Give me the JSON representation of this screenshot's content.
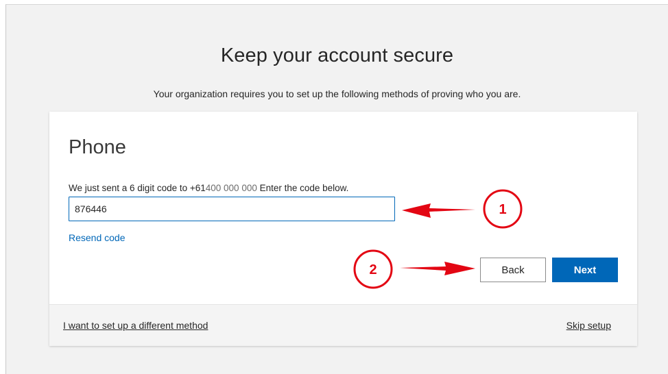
{
  "page": {
    "title": "Keep your account secure",
    "subtitle": "Your organization requires you to set up the following methods of proving who you are."
  },
  "card": {
    "method_title": "Phone",
    "instruction_prefix": "We just sent a 6 digit code to +61",
    "instruction_phone": "400 000 000",
    "instruction_suffix": " Enter the code below.",
    "code_value": "876446",
    "resend_label": "Resend code",
    "back_label": "Back",
    "next_label": "Next"
  },
  "footer": {
    "different_method_label": "I want to set up a different method",
    "skip_label": "Skip setup"
  },
  "annotations": {
    "marker_1": "1",
    "marker_2": "2"
  },
  "colors": {
    "accent": "#0067b8",
    "annotation": "#e30613",
    "background": "#f2f2f2"
  }
}
